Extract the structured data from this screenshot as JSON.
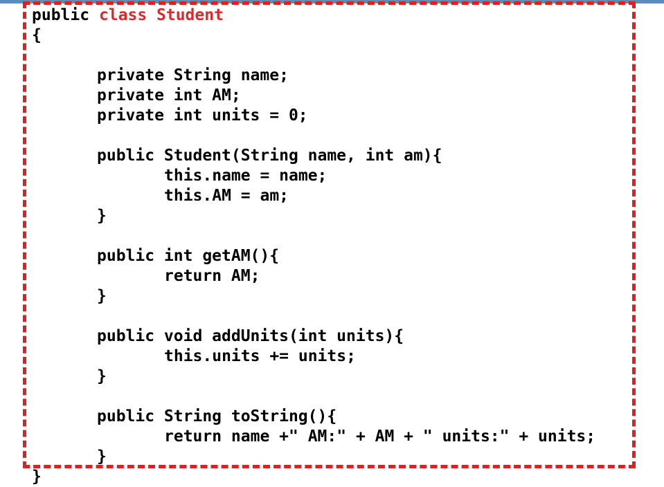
{
  "slide": {
    "kind": "code-listing-slide",
    "language": "Java",
    "class_name": "Student",
    "colors": {
      "top_rule": "#5b8db8",
      "frame_dashed": "#e02020",
      "code_text": "#000000",
      "keyword_red": "#d92b2b",
      "background": "#ffffff"
    }
  },
  "code": {
    "lines": [
      {
        "indent": 0,
        "segments": [
          {
            "text": "public ",
            "style": "plain"
          },
          {
            "text": "class Student",
            "style": "red"
          }
        ]
      },
      {
        "indent": 0,
        "segments": [
          {
            "text": "{",
            "style": "plain"
          }
        ]
      },
      {
        "indent": 0,
        "segments": [
          {
            "text": "",
            "style": "plain"
          }
        ]
      },
      {
        "indent": 1,
        "segments": [
          {
            "text": "private String name;",
            "style": "plain"
          }
        ]
      },
      {
        "indent": 1,
        "segments": [
          {
            "text": "private int AM;",
            "style": "plain"
          }
        ]
      },
      {
        "indent": 1,
        "segments": [
          {
            "text": "private int units = 0;",
            "style": "plain"
          }
        ]
      },
      {
        "indent": 0,
        "segments": [
          {
            "text": "",
            "style": "plain"
          }
        ]
      },
      {
        "indent": 1,
        "segments": [
          {
            "text": "public Student(String name, int am){",
            "style": "plain"
          }
        ]
      },
      {
        "indent": 2,
        "segments": [
          {
            "text": "this.name = name;",
            "style": "plain"
          }
        ]
      },
      {
        "indent": 2,
        "segments": [
          {
            "text": "this.AM = am;",
            "style": "plain"
          }
        ]
      },
      {
        "indent": 1,
        "segments": [
          {
            "text": "}",
            "style": "plain"
          }
        ]
      },
      {
        "indent": 0,
        "segments": [
          {
            "text": "",
            "style": "plain"
          }
        ]
      },
      {
        "indent": 1,
        "segments": [
          {
            "text": "public int getAM(){",
            "style": "plain"
          }
        ]
      },
      {
        "indent": 2,
        "segments": [
          {
            "text": "return AM;",
            "style": "plain"
          }
        ]
      },
      {
        "indent": 1,
        "segments": [
          {
            "text": "}",
            "style": "plain"
          }
        ]
      },
      {
        "indent": 0,
        "segments": [
          {
            "text": "",
            "style": "plain"
          }
        ]
      },
      {
        "indent": 1,
        "segments": [
          {
            "text": "public void addUnits(int units){",
            "style": "plain"
          }
        ]
      },
      {
        "indent": 2,
        "segments": [
          {
            "text": "this.units += units;",
            "style": "plain"
          }
        ]
      },
      {
        "indent": 1,
        "segments": [
          {
            "text": "}",
            "style": "plain"
          }
        ]
      },
      {
        "indent": 0,
        "segments": [
          {
            "text": "",
            "style": "plain"
          }
        ]
      },
      {
        "indent": 1,
        "segments": [
          {
            "text": "public String toString(){",
            "style": "plain"
          }
        ]
      },
      {
        "indent": 2,
        "segments": [
          {
            "text": "return name +\" AM:\" + AM + \" units:\" + units;",
            "style": "plain"
          }
        ]
      },
      {
        "indent": 1,
        "segments": [
          {
            "text": "}",
            "style": "plain"
          }
        ]
      },
      {
        "indent": 0,
        "segments": [
          {
            "text": "}",
            "style": "plain"
          }
        ]
      }
    ],
    "plain_text": "public class Student\n{\n\n     private String name;\n     private int AM;\n     private int units = 0;\n\n     public Student(String name, int am){\n          this.name = name;\n          this.AM = am;\n     }\n\n     public int getAM(){\n          return AM;\n     }\n\n     public void addUnits(int units){\n          this.units += units;\n     }\n\n     public String toString(){\n          return name +\" AM:\" + AM + \" units:\" + units;\n     }\n}"
  }
}
